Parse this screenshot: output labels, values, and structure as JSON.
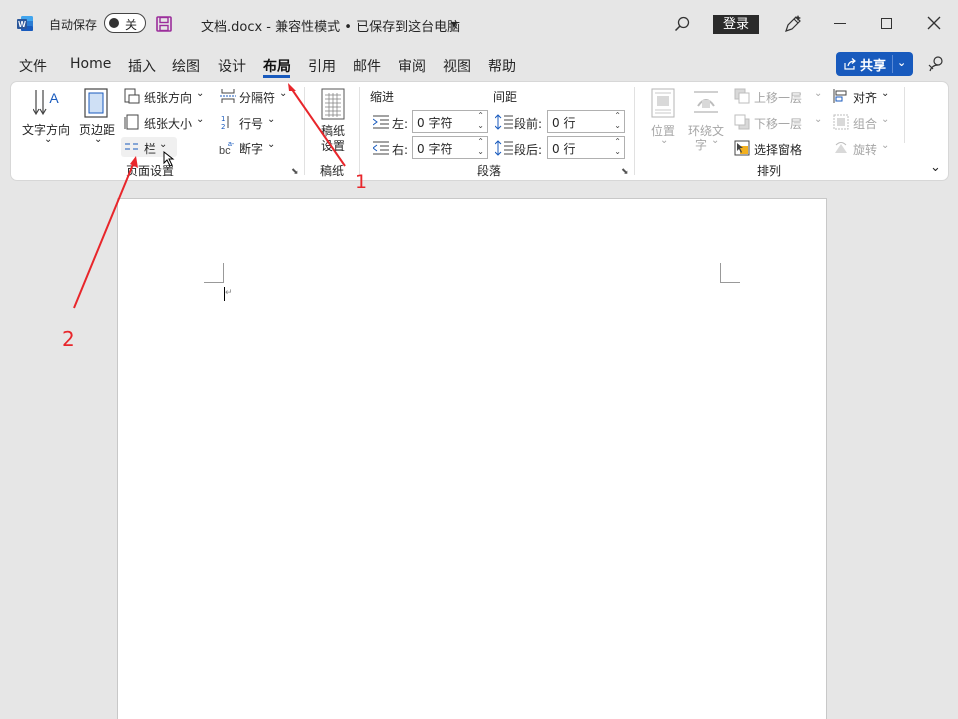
{
  "titlebar": {
    "autosave_label": "自动保存",
    "autosave_state": "关",
    "doc_title": "文档.docx  -  兼容性模式 • 已保存到这台电脑",
    "login_label": "登录"
  },
  "menu": {
    "items": [
      "文件",
      "Home",
      "插入",
      "绘图",
      "设计",
      "布局",
      "引用",
      "邮件",
      "审阅",
      "视图",
      "帮助"
    ],
    "active": "布局",
    "share_label": "共享"
  },
  "ribbon": {
    "page_setup": {
      "text_direction": "文字方向",
      "margins": "页边距",
      "orientation": "纸张方向",
      "size": "纸张大小",
      "columns": "栏",
      "breaks": "分隔符",
      "line_numbers": "行号",
      "hyphenation": "断字",
      "group_label": "页面设置"
    },
    "draft_paper": {
      "button_line1": "稿纸",
      "button_line2": "设置",
      "group_label": "稿纸"
    },
    "paragraph": {
      "indent_header": "缩进",
      "spacing_header": "间距",
      "left_label": "左:",
      "left_value": "0 字符",
      "right_label": "右:",
      "right_value": "0 字符",
      "before_label": "段前:",
      "before_value": "0 行",
      "after_label": "段后:",
      "after_value": "0 行",
      "group_label": "段落"
    },
    "arrange": {
      "position": "位置",
      "wrap_line1": "环绕文",
      "wrap_line2": "字",
      "bring_forward": "上移一层",
      "send_backward": "下移一层",
      "selection_pane": "选择窗格",
      "align": "对齐",
      "group": "组合",
      "rotate": "旋转",
      "group_label": "排列"
    }
  },
  "annotations": {
    "label_1": "1",
    "label_2": "2",
    "color": "#e8262b"
  },
  "colors": {
    "accent": "#185abd",
    "word_icon": "#2b579a",
    "save_icon": "#9b2d9b"
  }
}
